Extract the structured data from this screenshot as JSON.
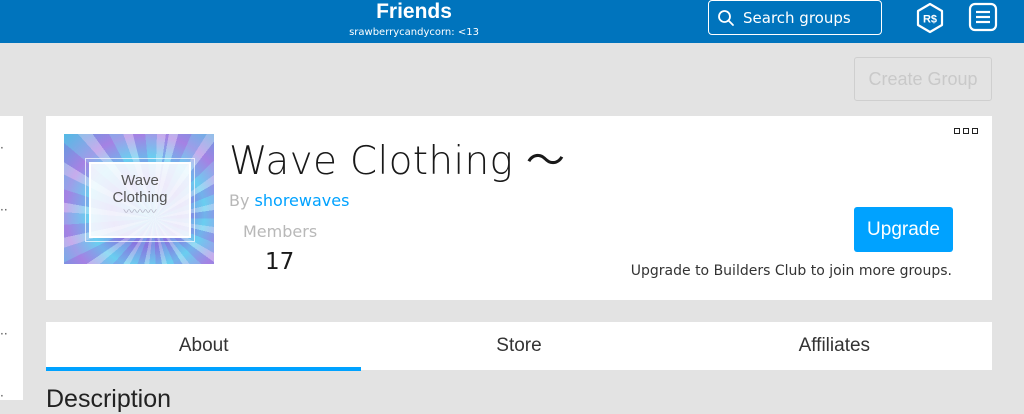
{
  "header": {
    "title": "Friends",
    "subtitle": "srawberrycandycorn: <13",
    "search_placeholder": "Search groups",
    "accent_color": "#0074bd"
  },
  "actions": {
    "create_group_label": "Create Group"
  },
  "group": {
    "name": "Wave Clothing 〜",
    "by_prefix": "By",
    "owner": "shorewaves",
    "members_label": "Members",
    "members_count": "17",
    "emblem_text_line1": "Wave",
    "emblem_text_line2": "Clothing",
    "emblem_waves": "〰〰〰",
    "upgrade_label": "Upgrade",
    "upgrade_note": "Upgrade to Builders Club to join more groups.",
    "link_color": "#00a2ff"
  },
  "tabs": [
    {
      "label": "About",
      "active": true
    },
    {
      "label": "Store",
      "active": false
    },
    {
      "label": "Affiliates",
      "active": false
    }
  ],
  "description_heading": "Description",
  "icons": {
    "search": "search-icon",
    "robux": "robux-icon",
    "menu": "menu-icon",
    "more": "more-options-icon"
  }
}
